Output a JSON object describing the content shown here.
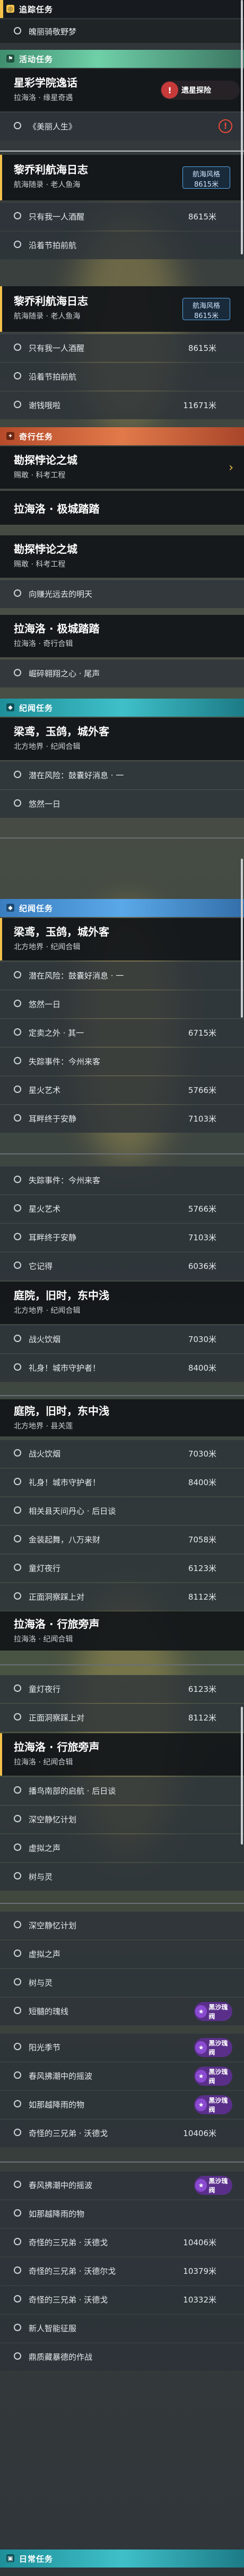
{
  "sections": {
    "follow": "追踪任务",
    "event": "活动任务",
    "adventure": "奇行任务",
    "chronicle": "纪闻任务",
    "daily": "日常任务"
  },
  "follow_quest": "魄丽骑敬野梦",
  "q_starstudy": {
    "title": "星彩学院逸话",
    "sub": "拉海洛 · 缘星奇遇",
    "badge": "遗星探险",
    "r1": "《美丽人生》"
  },
  "q_voyage": {
    "title": "黎乔利航海日志",
    "sub": "航海随录 · 老人鱼海",
    "r1": "只有我一人酒醒",
    "r1dist": "8615米",
    "r2": "沿着节拍前航",
    "r3": "谢钱哦啦",
    "r3dist": "11671米"
  },
  "q_voyage_tag": {
    "a": "航海风格",
    "b": "8615米"
  },
  "q_explore": {
    "title": "勘探悖论之城",
    "sub": "赐敢 · 科考工程",
    "r1": "向赚光远去的明天"
  },
  "q_lhl": {
    "title": "拉海洛 · 极城踏踏",
    "sub": "拉海洛 · 奇行合辑",
    "r1": "崛碎翱翔之心 · 尾声"
  },
  "q_lianghe": {
    "title": "梁鸢，玉鸽，城外客",
    "sub": "北方地界 · 纪闻合辑",
    "r1": "潜在风险：鼓囊好消息 · 一",
    "r2": "悠然一日",
    "r3": "定卖之外 · 其一",
    "r3dist": "6715米",
    "r4": "失踪事件：今州来客",
    "r5": "星火艺术",
    "r5dist": "5766米",
    "r6": "耳畔终于安静",
    "r6dist": "7103米"
  },
  "q_lianghe2": {
    "r1": "失踪事件：今州来客",
    "r2": "星火艺术",
    "r2dist": "5766米",
    "r3": "耳畔终于安静",
    "r3dist": "7103米",
    "r4": "它记得",
    "r4dist": "6036米"
  },
  "q_gengzheng": {
    "title": "庭院，旧时，东中浅",
    "sub": "北方地界 · 纪闻合辑",
    "r1": "战火饮烟",
    "r1dist": "7030米",
    "r2": "礼身！城市守护者！",
    "r2dist": "8400米"
  },
  "q_gengzheng2": {
    "title": "庭院，旧时，东中浅",
    "sub": "北方地界 · 县关莲",
    "r1": "战火饮烟",
    "r1dist": "7030米",
    "r2": "礼身！城市守护者！",
    "r2dist": "8400米",
    "r3": "相关县天问丹心 · 后日谈",
    "r4": "金装起舞，八万来财",
    "r4dist": "7058米",
    "r5": "童灯夜行",
    "r5dist": "6123米",
    "r6": "正面洞察踩上对",
    "r6dist": "8112米"
  },
  "q_travel": {
    "title": "拉海洛 · 行旅旁声",
    "sub": "拉海洛 · 纪闻合辑",
    "r1": "童灯夜行",
    "r1dist": "6123米",
    "r2": "正面洞察踩上对",
    "r2dist": "8112米"
  },
  "q_travel2": {
    "title": "拉海洛 · 行旅旁声",
    "sub": "拉海洛 · 纪闻合辑",
    "r1": "播鸟南部的启航 · 后日谈",
    "r2": "深空静忆计划",
    "r3": "虚拟之声",
    "r4": "树与灵",
    "r5": "深空静忆计划",
    "r6": "虚拟之声",
    "r7": "树与灵",
    "r8": "短髓的瑰线"
  },
  "q_last": {
    "r1": "阳光季节",
    "r2": "春风拂潮中的摇波",
    "r3": "如那越降雨的物",
    "r4": "奇怪的三兄弟 · 沃德戈",
    "r4dist": "10406米",
    "r5": "春风拂潮中的摇波",
    "r6": "如那越降雨的物",
    "r7": "奇怪的三兄弟 · 沃德戈",
    "r7dist": "10406米",
    "r8": "奇怪的三兄弟 · 沃德尔戈",
    "r8dist": "10379米",
    "r9": "奇怪的三兄弟 · 沃德戈",
    "r9dist": "10332米",
    "r10": "新人智能征服",
    "r11": "鼎质藏暴德的作战"
  },
  "purple_badge": "黑沙瑰阀",
  "icons": {
    "check": "circle-icon",
    "warn": "warning-icon",
    "chevron": "chevron-icon"
  }
}
